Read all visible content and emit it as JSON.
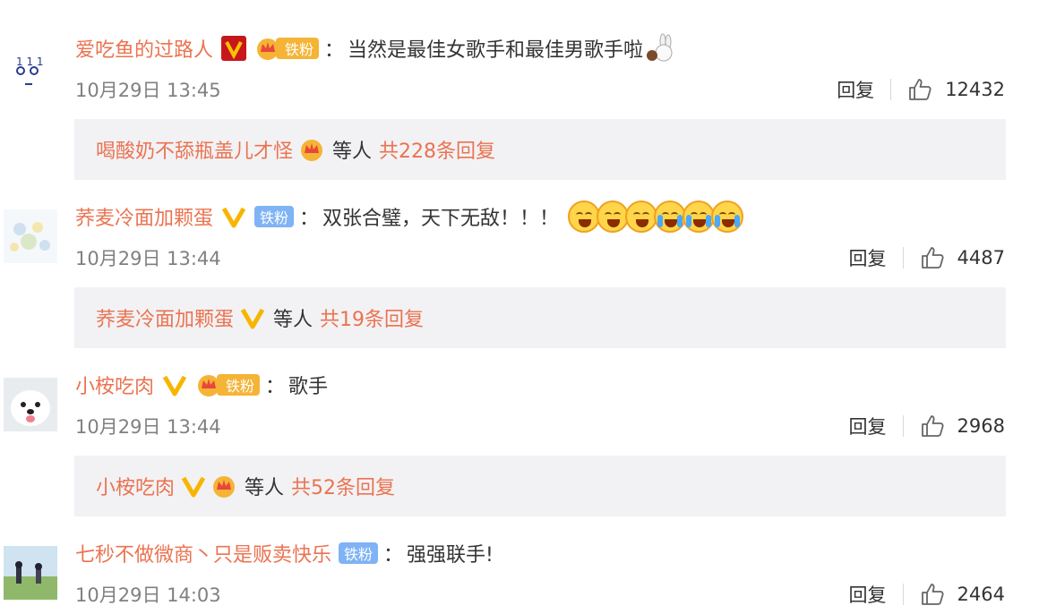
{
  "comments": [
    {
      "username": "爱吃鱼的过路人",
      "fan_label": "铁粉",
      "colon": "：",
      "text": "当然是最佳女歌手和最佳男歌手啦",
      "time": "10月29日 13:45",
      "reply_label": "回复",
      "likes": "12432",
      "reply_user": "喝酸奶不舔瓶盖儿才怪",
      "etc": "等人",
      "reply_count": "共228条回复"
    },
    {
      "username": "荞麦冷面加颗蛋",
      "fan_label": "铁粉",
      "colon": "：",
      "text": "双张合璧，天下无敌！！！",
      "time": "10月29日 13:44",
      "reply_label": "回复",
      "likes": "4487",
      "reply_user": "荞麦冷面加颗蛋",
      "etc": "等人",
      "reply_count": "共19条回复"
    },
    {
      "username": "小桉吃肉",
      "fan_label": "铁粉",
      "colon": "：",
      "text": "歌手",
      "time": "10月29日 13:44",
      "reply_label": "回复",
      "likes": "2968",
      "reply_user": "小桉吃肉",
      "etc": "等人",
      "reply_count": "共52条回复"
    },
    {
      "username": "七秒不做微商丶只是贩卖快乐",
      "fan_label": "铁粉",
      "colon": "：",
      "text": "强强联手!",
      "time": "10月29日 14:03",
      "reply_label": "回复",
      "likes": "2464"
    }
  ],
  "colors": {
    "username": "#eb7350",
    "meta": "#808080",
    "reply_panel_bg": "#f2f2f5",
    "fan_gold": "#f5b436",
    "fan_blue": "#7fb3f5",
    "vip_gold": "#f7b500",
    "vip_red": "#c8161d"
  },
  "icons": {
    "like": "thumbs-up-icon",
    "verified": "verified-v-icon",
    "crown": "crown-icon"
  }
}
